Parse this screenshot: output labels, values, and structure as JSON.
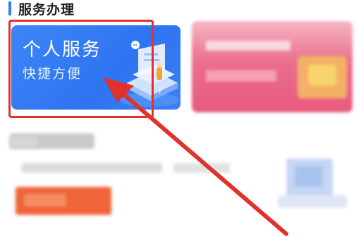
{
  "section": {
    "title": "服务办理"
  },
  "service_card": {
    "title": "个人服务",
    "subtitle": "快捷方便",
    "bg_color": "#2f74f1"
  },
  "annotation": {
    "color": "#e0322d"
  }
}
